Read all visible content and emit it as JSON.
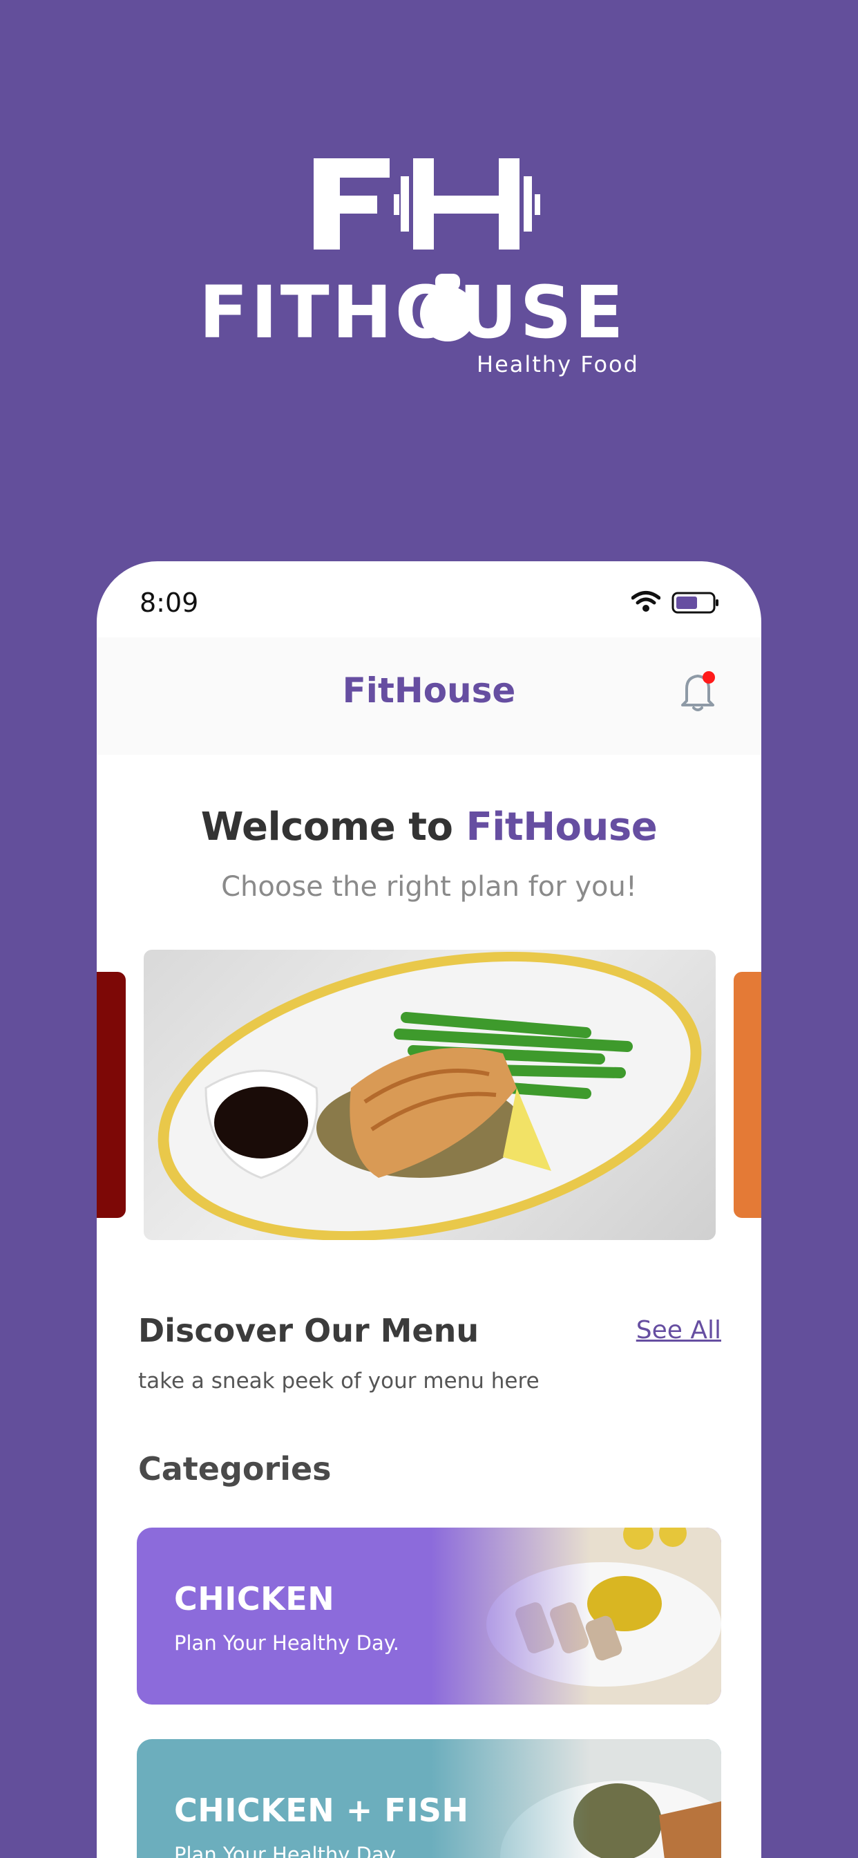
{
  "brand": {
    "logo_letters": "FH",
    "wordmark": "FITHOUSE",
    "tagline": "Healthy Food"
  },
  "status_bar": {
    "time": "8:09",
    "icons": [
      "wifi-icon",
      "battery-icon"
    ]
  },
  "header": {
    "title": "FitHouse",
    "notification_icon": "bell-icon",
    "notification_dot_color": "#ff1a1a"
  },
  "welcome": {
    "prefix": "Welcome to ",
    "brand": "FitHouse",
    "subtitle": "Choose the right plan for you!"
  },
  "menu": {
    "title": "Discover Our Menu",
    "see_all": "See All",
    "subtitle": "take a sneak peek of your menu here"
  },
  "categories": {
    "title": "Categories",
    "items": [
      {
        "name": "CHICKEN",
        "description": "Plan Your Healthy Day.",
        "color": "#8c6bdb"
      },
      {
        "name": "CHICKEN + FISH",
        "description": "Plan Your Healthy Day.",
        "color": "#6caebd"
      }
    ]
  },
  "colors": {
    "background": "#634f9b",
    "accent": "#664ea1",
    "text_dark": "#3b3b3b",
    "text_muted": "#8a8a8a"
  }
}
